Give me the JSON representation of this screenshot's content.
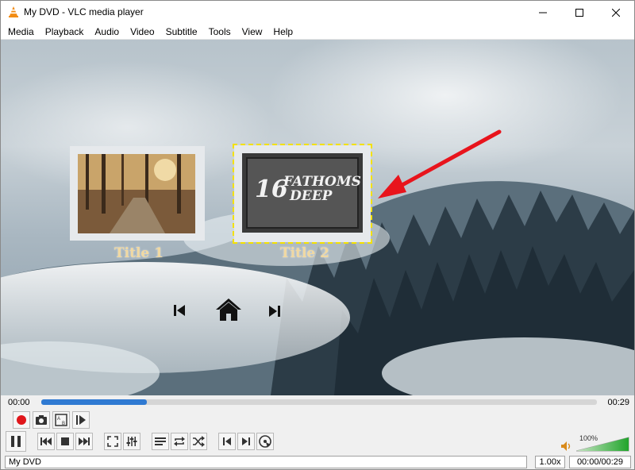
{
  "window": {
    "title": "My DVD - VLC media player"
  },
  "menu": [
    "Media",
    "Playback",
    "Audio",
    "Video",
    "Subtitle",
    "Tools",
    "View",
    "Help"
  ],
  "dvd_menu": {
    "titles": [
      {
        "label": "Title 1"
      },
      {
        "label": "Title 2",
        "selected": true
      }
    ],
    "title2_poster_text": [
      "16",
      "FATHOMS",
      "DEEP"
    ],
    "nav_icons": [
      "previous-icon",
      "home-icon",
      "next-icon"
    ]
  },
  "seek": {
    "elapsed": "00:00",
    "total": "00:29",
    "progress_fraction": 0.19
  },
  "controls": {
    "row1": [
      "record-icon",
      "snapshot-icon",
      "loop-ab-icon",
      "frame-step-icon"
    ],
    "row2": [
      "pause-icon",
      "previous-icon",
      "stop-icon",
      "next-icon",
      "fullscreen-icon",
      "extended-settings-icon",
      "playlist-icon",
      "loop-icon",
      "shuffle-icon",
      "prev-chapter-icon",
      "next-chapter-icon",
      "dvd-menu-icon"
    ]
  },
  "volume": {
    "label": "100%",
    "level_fraction": 1.0
  },
  "status": {
    "media": "My DVD",
    "speed": "1.00x",
    "time": "00:00/00:29"
  },
  "colors": {
    "accent": "#2f7ad2",
    "record": "#e0161b",
    "volume": "#2fb12f",
    "title_label": "#f1d9a2",
    "arrow": "#e8141c"
  }
}
